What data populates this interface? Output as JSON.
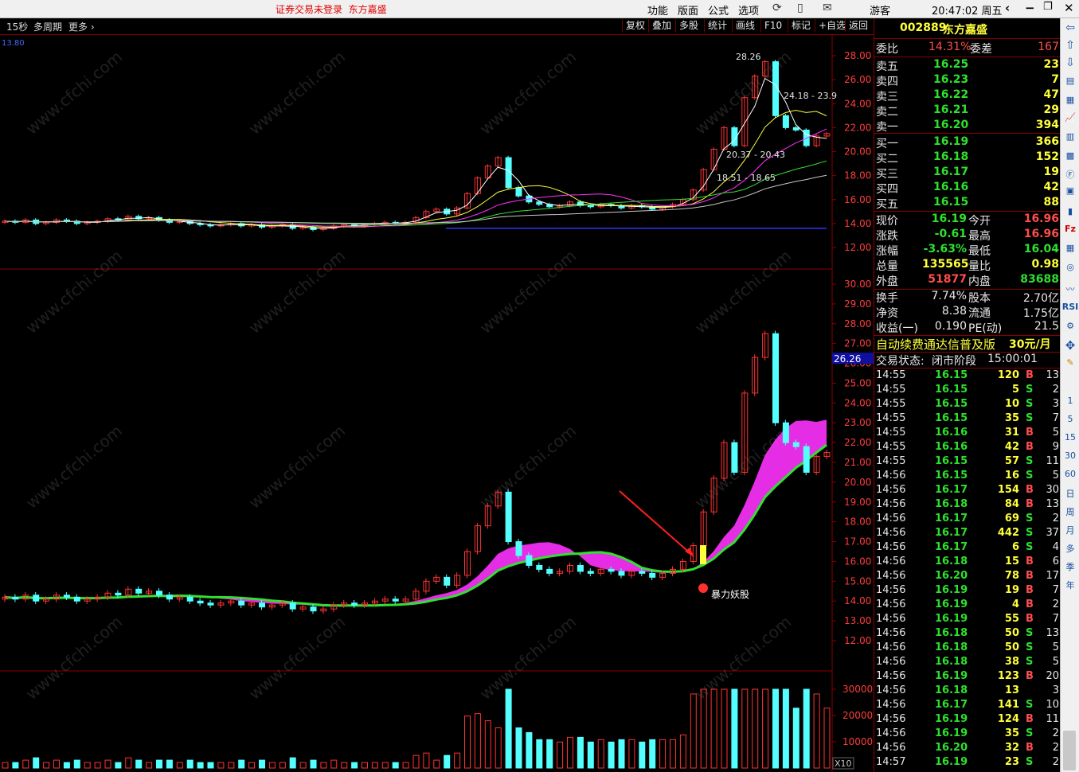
{
  "titlebar": {
    "alert": "证券交易未登录",
    "stock_name_alert": "东方嘉盛",
    "menus": [
      "功能",
      "版面",
      "公式",
      "选项"
    ],
    "user": "游客",
    "clock": "20:47:02 周五"
  },
  "subbar": {
    "period": "15秒",
    "multi_period": "多周期",
    "more": "更多",
    "buttons": [
      "复权",
      "叠加",
      "多股",
      "统计",
      "画线",
      "F10",
      "标记",
      "+自选",
      "返回"
    ]
  },
  "main_chart": {
    "top_label": "13.80",
    "y_ticks": [
      "28.00",
      "26.00",
      "24.00",
      "22.00",
      "20.00",
      "18.00",
      "16.00",
      "14.00",
      "12.00"
    ],
    "annotations": [
      "28.26",
      "24.18 - 23.9",
      "20.37 - 20.43",
      "18.51 - 18.65"
    ]
  },
  "indicator_chart": {
    "y_ticks": [
      "30.00",
      "29.00",
      "28.00",
      "27.00",
      "26.00",
      "25.00",
      "24.00",
      "23.00",
      "22.00",
      "21.00",
      "20.00",
      "19.00",
      "18.00",
      "17.00",
      "16.00",
      "15.00",
      "14.00",
      "13.00",
      "12.00"
    ],
    "current_price_tag": "26.26",
    "signal_label": "暴力妖股"
  },
  "volume_chart": {
    "y_ticks": [
      "30000",
      "20000",
      "10000"
    ],
    "unit": "X10"
  },
  "watermark": "www.cfchi.com",
  "panel": {
    "code": "002889",
    "name": "东方嘉盛",
    "weibi_label": "委比",
    "weibi": "14.31%",
    "weicha_label": "委差",
    "weicha": "167",
    "asks": [
      {
        "label": "卖五",
        "price": "16.25",
        "vol": "23"
      },
      {
        "label": "卖四",
        "price": "16.23",
        "vol": "7"
      },
      {
        "label": "卖三",
        "price": "16.22",
        "vol": "47"
      },
      {
        "label": "卖二",
        "price": "16.21",
        "vol": "29"
      },
      {
        "label": "卖一",
        "price": "16.20",
        "vol": "394"
      }
    ],
    "bids": [
      {
        "label": "买一",
        "price": "16.19",
        "vol": "366"
      },
      {
        "label": "买二",
        "price": "16.18",
        "vol": "152"
      },
      {
        "label": "买三",
        "price": "16.17",
        "vol": "19"
      },
      {
        "label": "买四",
        "price": "16.16",
        "vol": "42"
      },
      {
        "label": "买五",
        "price": "16.15",
        "vol": "88"
      }
    ],
    "quote": [
      {
        "l1": "现价",
        "v1": "16.19",
        "c1": "green",
        "l2": "今开",
        "v2": "16.96",
        "c2": "red"
      },
      {
        "l1": "涨跌",
        "v1": "-0.61",
        "c1": "green",
        "l2": "最高",
        "v2": "16.96",
        "c2": "red"
      },
      {
        "l1": "涨幅",
        "v1": "-3.63%",
        "c1": "green",
        "l2": "最低",
        "v2": "16.04",
        "c2": "green"
      },
      {
        "l1": "总量",
        "v1": "135565",
        "c1": "yellow",
        "l2": "量比",
        "v2": "0.98",
        "c2": "yellow"
      },
      {
        "l1": "外盘",
        "v1": "51877",
        "c1": "red",
        "l2": "内盘",
        "v2": "83688",
        "c2": "green"
      }
    ],
    "fundamentals": [
      {
        "l1": "换手",
        "v1": "7.74%",
        "l2": "股本",
        "v2": "2.70亿"
      },
      {
        "l1": "净资",
        "v1": "8.38",
        "l2": "流通",
        "v2": "1.75亿"
      },
      {
        "l1": "收益(一)",
        "v1": "0.190",
        "l2": "PE(动)",
        "v2": "21.5"
      }
    ],
    "promo": "自动续费通达信普及版",
    "promo_price": "30元/月",
    "status_label": "交易状态:",
    "status_value": "闭市阶段",
    "status_time": "15:00:01",
    "ticks": [
      {
        "t": "14:55",
        "p": "16.15",
        "v": "120",
        "bs": "B",
        "n": "13"
      },
      {
        "t": "14:55",
        "p": "16.15",
        "v": "5",
        "bs": "S",
        "n": "2"
      },
      {
        "t": "14:55",
        "p": "16.15",
        "v": "10",
        "bs": "S",
        "n": "3"
      },
      {
        "t": "14:55",
        "p": "16.15",
        "v": "35",
        "bs": "S",
        "n": "7"
      },
      {
        "t": "14:55",
        "p": "16.16",
        "v": "31",
        "bs": "B",
        "n": "5"
      },
      {
        "t": "14:55",
        "p": "16.16",
        "v": "42",
        "bs": "B",
        "n": "9"
      },
      {
        "t": "14:55",
        "p": "16.15",
        "v": "57",
        "bs": "S",
        "n": "11"
      },
      {
        "t": "14:56",
        "p": "16.15",
        "v": "16",
        "bs": "S",
        "n": "5"
      },
      {
        "t": "14:56",
        "p": "16.17",
        "v": "154",
        "bs": "B",
        "n": "30"
      },
      {
        "t": "14:56",
        "p": "16.18",
        "v": "84",
        "bs": "B",
        "n": "13"
      },
      {
        "t": "14:56",
        "p": "16.17",
        "v": "69",
        "bs": "S",
        "n": "2"
      },
      {
        "t": "14:56",
        "p": "16.17",
        "v": "442",
        "bs": "S",
        "n": "37"
      },
      {
        "t": "14:56",
        "p": "16.17",
        "v": "6",
        "bs": "S",
        "n": "4"
      },
      {
        "t": "14:56",
        "p": "16.18",
        "v": "15",
        "bs": "B",
        "n": "6"
      },
      {
        "t": "14:56",
        "p": "16.20",
        "v": "78",
        "bs": "B",
        "n": "17"
      },
      {
        "t": "14:56",
        "p": "16.19",
        "v": "19",
        "bs": "B",
        "n": "7"
      },
      {
        "t": "14:56",
        "p": "16.19",
        "v": "4",
        "bs": "B",
        "n": "2"
      },
      {
        "t": "14:56",
        "p": "16.19",
        "v": "55",
        "bs": "B",
        "n": "7"
      },
      {
        "t": "14:56",
        "p": "16.18",
        "v": "50",
        "bs": "S",
        "n": "13"
      },
      {
        "t": "14:56",
        "p": "16.18",
        "v": "50",
        "bs": "S",
        "n": "5"
      },
      {
        "t": "14:56",
        "p": "16.18",
        "v": "38",
        "bs": "S",
        "n": "5"
      },
      {
        "t": "14:56",
        "p": "16.19",
        "v": "123",
        "bs": "B",
        "n": "20"
      },
      {
        "t": "14:56",
        "p": "16.18",
        "v": "13",
        "bs": "",
        "n": "3"
      },
      {
        "t": "14:56",
        "p": "16.17",
        "v": "141",
        "bs": "S",
        "n": "10"
      },
      {
        "t": "14:56",
        "p": "16.19",
        "v": "124",
        "bs": "B",
        "n": "11"
      },
      {
        "t": "14:56",
        "p": "16.19",
        "v": "35",
        "bs": "S",
        "n": "2"
      },
      {
        "t": "14:56",
        "p": "16.20",
        "v": "32",
        "bs": "B",
        "n": "2"
      },
      {
        "t": "14:57",
        "p": "16.19",
        "v": "23",
        "bs": "S",
        "n": "2"
      }
    ]
  },
  "rightbar": {
    "periods": [
      "1",
      "5",
      "15",
      "30",
      "60",
      "日",
      "周",
      "月",
      "多",
      "季",
      "年"
    ],
    "rsi_label": "RSI"
  },
  "colors": {
    "up": "#ff3232",
    "down": "#54ffff",
    "ma_magenta": "#ff32ff",
    "ma_green": "#32e032",
    "accent": "#ffff3c"
  }
}
